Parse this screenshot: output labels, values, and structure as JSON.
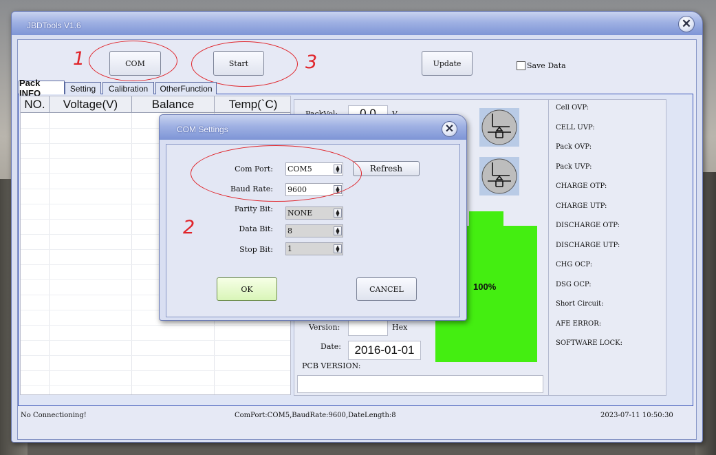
{
  "window": {
    "title": "JBDTools V1.6",
    "close_glyph": "✕"
  },
  "toolbar": {
    "com_label": "COM",
    "start_label": "Start",
    "update_label": "Update",
    "save_data_label": "Save Data"
  },
  "annotations": {
    "n1": "1",
    "n2": "2",
    "n3": "3",
    "color": "#e0242a"
  },
  "tabs": [
    {
      "label": "Pack INFO"
    },
    {
      "label": "Setting"
    },
    {
      "label": "Calibration"
    },
    {
      "label": "OtherFunction"
    }
  ],
  "table": {
    "headers": [
      "NO.",
      "Voltage(V)",
      "Balance",
      "Temp(`C)"
    ]
  },
  "info": {
    "packvol_label": "PackVol:",
    "packvol_value": "0.0",
    "packvol_unit": "V",
    "version_label": "Version:",
    "version_value": "",
    "version_unit": "Hex",
    "date_label": "Date:",
    "date_value": "2016-01-01",
    "pcb_label": "PCB VERSION:",
    "pcb_value": "",
    "battery_percent": "100%",
    "battery_color": "#44ee11"
  },
  "protections": [
    "Cell OVP:",
    "CELL UVP:",
    "Pack OVP:",
    "Pack UVP:",
    "CHARGE OTP:",
    "CHARGE UTP:",
    "DISCHARGE OTP:",
    "DISCHARGE UTP:",
    "CHG OCP:",
    "DSG OCP:",
    "Short Circuit:",
    "AFE ERROR:",
    "SOFTWARE LOCK:"
  ],
  "status": {
    "connection": "No Connectioning!",
    "port_info": "ComPort:COM5,BaudRate:9600,DateLength:8",
    "datetime": "2023-07-11 10:50:30"
  },
  "dialog": {
    "title": "COM Settings",
    "com_port_label": "Com Port:",
    "com_port_value": "COM5",
    "refresh_label": "Refresh",
    "baud_rate_label": "Baud Rate:",
    "baud_rate_value": "9600",
    "parity_label": "Parity Bit:",
    "parity_value": "NONE",
    "data_bit_label": "Data Bit:",
    "data_bit_value": "8",
    "stop_bit_label": "Stop Bit:",
    "stop_bit_value": "1",
    "ok_label": "OK",
    "cancel_label": "CANCEL"
  }
}
